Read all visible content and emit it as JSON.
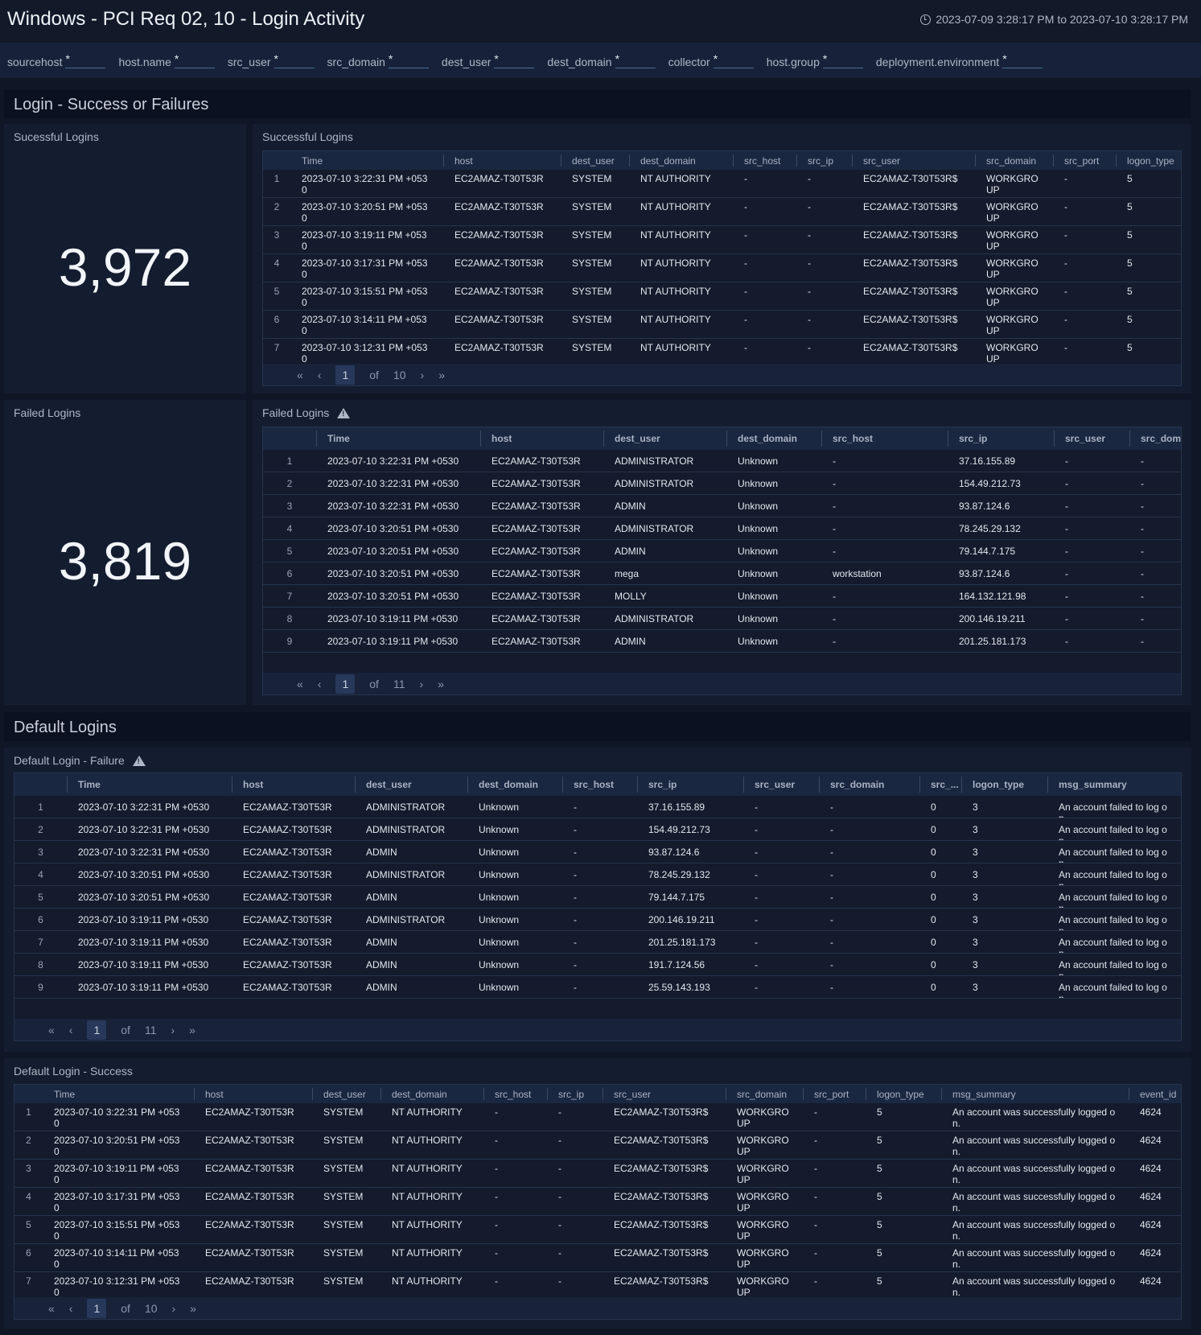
{
  "header": {
    "title": "Windows - PCI Req 02, 10 - Login Activity",
    "time_range": "2023-07-09 3:28:17 PM to 2023-07-10 3:28:17 PM"
  },
  "filters": [
    {
      "label": "sourcehost",
      "value": "*"
    },
    {
      "label": "host.name",
      "value": "*"
    },
    {
      "label": "src_user",
      "value": "*"
    },
    {
      "label": "src_domain",
      "value": "*"
    },
    {
      "label": "dest_user",
      "value": "*"
    },
    {
      "label": "dest_domain",
      "value": "*"
    },
    {
      "label": "collector",
      "value": "*"
    },
    {
      "label": "host.group",
      "value": "*"
    },
    {
      "label": "deployment.environment",
      "value": "*"
    }
  ],
  "sections": {
    "login": "Login - Success or Failures",
    "default": "Default Logins"
  },
  "panels": {
    "successful_count": {
      "title": "Sucessful Logins",
      "value": "3,972"
    },
    "failed_count": {
      "title": "Failed Logins",
      "value": "3,819"
    },
    "successful_table": {
      "title": "Successful Logins",
      "pager": {
        "page": "1",
        "of": "of",
        "total": "10"
      }
    },
    "failed_table": {
      "title": "Failed Logins",
      "warning_icon": "warning-triangle-icon",
      "pager": {
        "page": "1",
        "of": "of",
        "total": "11"
      }
    },
    "default_failure": {
      "title": "Default Login - Failure",
      "warning_icon": "warning-triangle-icon",
      "pager": {
        "page": "1",
        "of": "of",
        "total": "11"
      }
    },
    "default_success": {
      "title": "Default Login - Success",
      "pager": {
        "page": "1",
        "of": "of",
        "total": "10"
      }
    }
  },
  "tables": {
    "successful_table": {
      "columns": [
        "",
        "Time",
        "host",
        "dest_user",
        "dest_domain",
        "src_host",
        "src_ip",
        "src_user",
        "src_domain",
        "src_port",
        "logon_type"
      ],
      "rows": [
        [
          "1",
          "2023-07-10 3:22:31 PM +0530",
          "EC2AMAZ-T30T53R",
          "SYSTEM",
          "NT AUTHORITY",
          "-",
          "-",
          "EC2AMAZ-T30T53R$",
          "WORKGROUP",
          "-",
          "5"
        ],
        [
          "2",
          "2023-07-10 3:20:51 PM +0530",
          "EC2AMAZ-T30T53R",
          "SYSTEM",
          "NT AUTHORITY",
          "-",
          "-",
          "EC2AMAZ-T30T53R$",
          "WORKGROUP",
          "-",
          "5"
        ],
        [
          "3",
          "2023-07-10 3:19:11 PM +0530",
          "EC2AMAZ-T30T53R",
          "SYSTEM",
          "NT AUTHORITY",
          "-",
          "-",
          "EC2AMAZ-T30T53R$",
          "WORKGROUP",
          "-",
          "5"
        ],
        [
          "4",
          "2023-07-10 3:17:31 PM +0530",
          "EC2AMAZ-T30T53R",
          "SYSTEM",
          "NT AUTHORITY",
          "-",
          "-",
          "EC2AMAZ-T30T53R$",
          "WORKGROUP",
          "-",
          "5"
        ],
        [
          "5",
          "2023-07-10 3:15:51 PM +0530",
          "EC2AMAZ-T30T53R",
          "SYSTEM",
          "NT AUTHORITY",
          "-",
          "-",
          "EC2AMAZ-T30T53R$",
          "WORKGROUP",
          "-",
          "5"
        ],
        [
          "6",
          "2023-07-10 3:14:11 PM +0530",
          "EC2AMAZ-T30T53R",
          "SYSTEM",
          "NT AUTHORITY",
          "-",
          "-",
          "EC2AMAZ-T30T53R$",
          "WORKGROUP",
          "-",
          "5"
        ],
        [
          "7",
          "2023-07-10 3:12:31 PM +0530",
          "EC2AMAZ-T30T53R",
          "SYSTEM",
          "NT AUTHORITY",
          "-",
          "-",
          "EC2AMAZ-T30T53R$",
          "WORKGROUP",
          "-",
          "5"
        ]
      ]
    },
    "failed_table": {
      "columns": [
        "",
        "Time",
        "host",
        "dest_user",
        "dest_domain",
        "src_host",
        "src_ip",
        "src_user",
        "src_dom"
      ],
      "rows": [
        [
          "1",
          "2023-07-10 3:22:31 PM +0530",
          "EC2AMAZ-T30T53R",
          "ADMINISTRATOR",
          "Unknown",
          "-",
          "37.16.155.89",
          "-",
          "-"
        ],
        [
          "2",
          "2023-07-10 3:22:31 PM +0530",
          "EC2AMAZ-T30T53R",
          "ADMINISTRATOR",
          "Unknown",
          "-",
          "154.49.212.73",
          "-",
          "-"
        ],
        [
          "3",
          "2023-07-10 3:22:31 PM +0530",
          "EC2AMAZ-T30T53R",
          "ADMIN",
          "Unknown",
          "-",
          "93.87.124.6",
          "-",
          "-"
        ],
        [
          "4",
          "2023-07-10 3:20:51 PM +0530",
          "EC2AMAZ-T30T53R",
          "ADMINISTRATOR",
          "Unknown",
          "-",
          "78.245.29.132",
          "-",
          "-"
        ],
        [
          "5",
          "2023-07-10 3:20:51 PM +0530",
          "EC2AMAZ-T30T53R",
          "ADMIN",
          "Unknown",
          "-",
          "79.144.7.175",
          "-",
          "-"
        ],
        [
          "6",
          "2023-07-10 3:20:51 PM +0530",
          "EC2AMAZ-T30T53R",
          "mega",
          "Unknown",
          "workstation",
          "93.87.124.6",
          "-",
          "-"
        ],
        [
          "7",
          "2023-07-10 3:20:51 PM +0530",
          "EC2AMAZ-T30T53R",
          "MOLLY",
          "Unknown",
          "-",
          "164.132.121.98",
          "-",
          "-"
        ],
        [
          "8",
          "2023-07-10 3:19:11 PM +0530",
          "EC2AMAZ-T30T53R",
          "ADMINISTRATOR",
          "Unknown",
          "-",
          "200.146.19.211",
          "-",
          "-"
        ],
        [
          "9",
          "2023-07-10 3:19:11 PM +0530",
          "EC2AMAZ-T30T53R",
          "ADMIN",
          "Unknown",
          "-",
          "201.25.181.173",
          "-",
          "-"
        ]
      ]
    },
    "default_failure": {
      "columns": [
        "",
        "Time",
        "host",
        "dest_user",
        "dest_domain",
        "src_host",
        "src_ip",
        "src_user",
        "src_domain",
        "src_...",
        "logon_type",
        "msg_summary"
      ],
      "rows": [
        [
          "1",
          "2023-07-10 3:22:31 PM +0530",
          "EC2AMAZ-T30T53R",
          "ADMINISTRATOR",
          "Unknown",
          "-",
          "37.16.155.89",
          "-",
          "-",
          "0",
          "3",
          "An account failed to log on."
        ],
        [
          "2",
          "2023-07-10 3:22:31 PM +0530",
          "EC2AMAZ-T30T53R",
          "ADMINISTRATOR",
          "Unknown",
          "-",
          "154.49.212.73",
          "-",
          "-",
          "0",
          "3",
          "An account failed to log on."
        ],
        [
          "3",
          "2023-07-10 3:22:31 PM +0530",
          "EC2AMAZ-T30T53R",
          "ADMIN",
          "Unknown",
          "-",
          "93.87.124.6",
          "-",
          "-",
          "0",
          "3",
          "An account failed to log on."
        ],
        [
          "4",
          "2023-07-10 3:20:51 PM +0530",
          "EC2AMAZ-T30T53R",
          "ADMINISTRATOR",
          "Unknown",
          "-",
          "78.245.29.132",
          "-",
          "-",
          "0",
          "3",
          "An account failed to log on."
        ],
        [
          "5",
          "2023-07-10 3:20:51 PM +0530",
          "EC2AMAZ-T30T53R",
          "ADMIN",
          "Unknown",
          "-",
          "79.144.7.175",
          "-",
          "-",
          "0",
          "3",
          "An account failed to log on."
        ],
        [
          "6",
          "2023-07-10 3:19:11 PM +0530",
          "EC2AMAZ-T30T53R",
          "ADMINISTRATOR",
          "Unknown",
          "-",
          "200.146.19.211",
          "-",
          "-",
          "0",
          "3",
          "An account failed to log on."
        ],
        [
          "7",
          "2023-07-10 3:19:11 PM +0530",
          "EC2AMAZ-T30T53R",
          "ADMIN",
          "Unknown",
          "-",
          "201.25.181.173",
          "-",
          "-",
          "0",
          "3",
          "An account failed to log on."
        ],
        [
          "8",
          "2023-07-10 3:19:11 PM +0530",
          "EC2AMAZ-T30T53R",
          "ADMIN",
          "Unknown",
          "-",
          "191.7.124.56",
          "-",
          "-",
          "0",
          "3",
          "An account failed to log on."
        ],
        [
          "9",
          "2023-07-10 3:19:11 PM +0530",
          "EC2AMAZ-T30T53R",
          "ADMIN",
          "Unknown",
          "-",
          "25.59.143.193",
          "-",
          "-",
          "0",
          "3",
          "An account failed to log on."
        ]
      ]
    },
    "default_success": {
      "columns": [
        "",
        "Time",
        "host",
        "dest_user",
        "dest_domain",
        "src_host",
        "src_ip",
        "src_user",
        "src_domain",
        "src_port",
        "logon_type",
        "msg_summary",
        "event_id"
      ],
      "rows": [
        [
          "1",
          "2023-07-10 3:22:31 PM +0530",
          "EC2AMAZ-T30T53R",
          "SYSTEM",
          "NT AUTHORITY",
          "-",
          "-",
          "EC2AMAZ-T30T53R$",
          "WORKGROUP",
          "-",
          "5",
          "An account was successfully logged on.",
          "4624"
        ],
        [
          "2",
          "2023-07-10 3:20:51 PM +0530",
          "EC2AMAZ-T30T53R",
          "SYSTEM",
          "NT AUTHORITY",
          "-",
          "-",
          "EC2AMAZ-T30T53R$",
          "WORKGROUP",
          "-",
          "5",
          "An account was successfully logged on.",
          "4624"
        ],
        [
          "3",
          "2023-07-10 3:19:11 PM +0530",
          "EC2AMAZ-T30T53R",
          "SYSTEM",
          "NT AUTHORITY",
          "-",
          "-",
          "EC2AMAZ-T30T53R$",
          "WORKGROUP",
          "-",
          "5",
          "An account was successfully logged on.",
          "4624"
        ],
        [
          "4",
          "2023-07-10 3:17:31 PM +0530",
          "EC2AMAZ-T30T53R",
          "SYSTEM",
          "NT AUTHORITY",
          "-",
          "-",
          "EC2AMAZ-T30T53R$",
          "WORKGROUP",
          "-",
          "5",
          "An account was successfully logged on.",
          "4624"
        ],
        [
          "5",
          "2023-07-10 3:15:51 PM +0530",
          "EC2AMAZ-T30T53R",
          "SYSTEM",
          "NT AUTHORITY",
          "-",
          "-",
          "EC2AMAZ-T30T53R$",
          "WORKGROUP",
          "-",
          "5",
          "An account was successfully logged on.",
          "4624"
        ],
        [
          "6",
          "2023-07-10 3:14:11 PM +0530",
          "EC2AMAZ-T30T53R",
          "SYSTEM",
          "NT AUTHORITY",
          "-",
          "-",
          "EC2AMAZ-T30T53R$",
          "WORKGROUP",
          "-",
          "5",
          "An account was successfully logged on.",
          "4624"
        ],
        [
          "7",
          "2023-07-10 3:12:31 PM +0530",
          "EC2AMAZ-T30T53R",
          "SYSTEM",
          "NT AUTHORITY",
          "-",
          "-",
          "EC2AMAZ-T30T53R$",
          "WORKGROUP",
          "-",
          "5",
          "An account was successfully logged on.",
          "4624"
        ]
      ]
    }
  }
}
